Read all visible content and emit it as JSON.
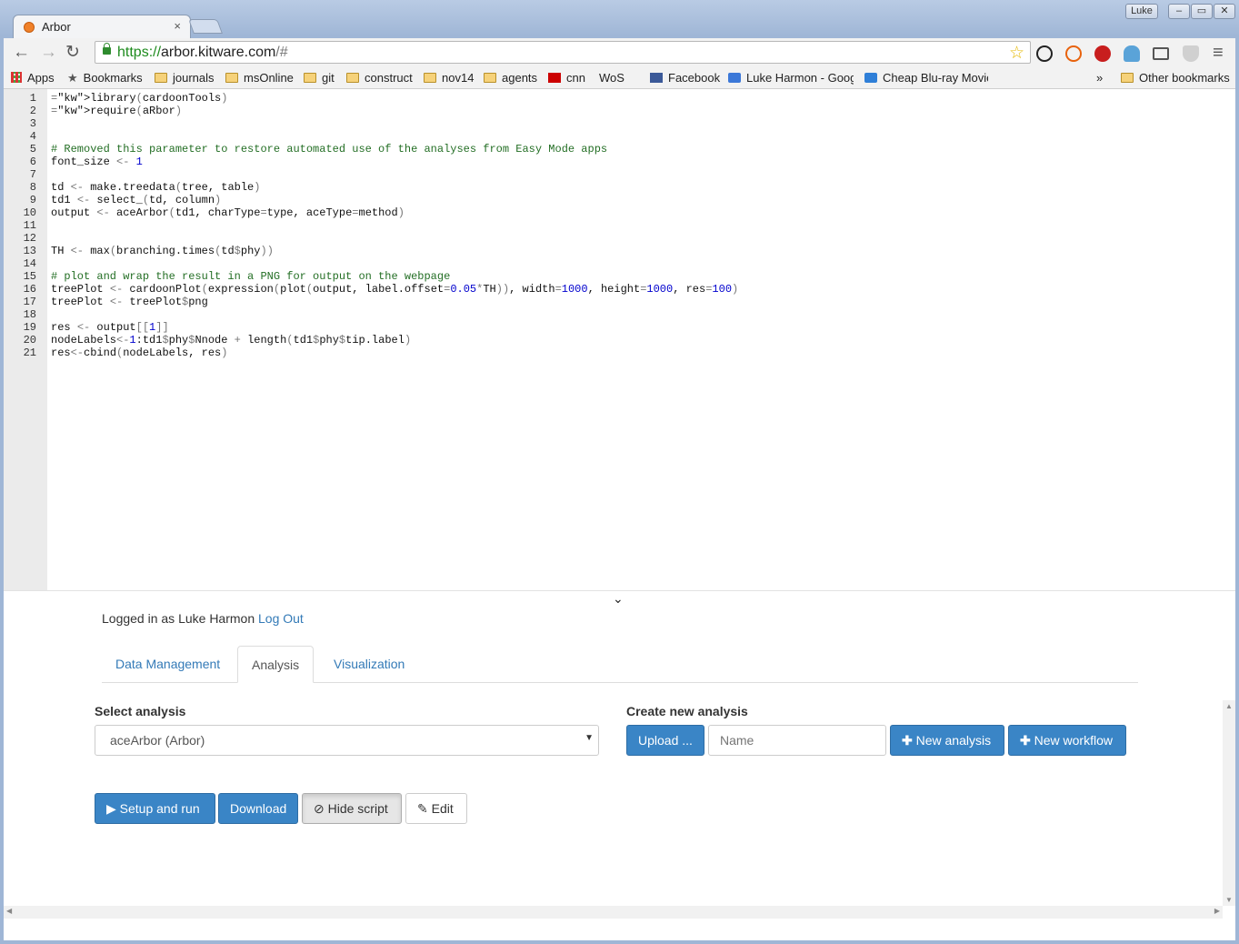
{
  "browser": {
    "tab_title": "Arbor",
    "tab_close": "×",
    "user_badge": "Luke",
    "window_controls": [
      "–",
      "▭",
      "✕"
    ],
    "url_scheme": "https://",
    "url_host": "arbor.kitware.com",
    "url_path": "/#",
    "back_glyph": "←",
    "forward_glyph": "→",
    "reload_glyph": "↻",
    "menu_glyph": "≡",
    "star_glyph": "☆",
    "bookmarks": [
      {
        "label": "Apps",
        "icon": "apps-icon"
      },
      {
        "label": "Bookmarks",
        "icon": "star-icon"
      },
      {
        "label": "journals",
        "icon": "folder-icon"
      },
      {
        "label": "msOnline",
        "icon": "folder-icon"
      },
      {
        "label": "git",
        "icon": "folder-icon"
      },
      {
        "label": "construct",
        "icon": "folder-icon"
      },
      {
        "label": "nov14",
        "icon": "folder-icon"
      },
      {
        "label": "agents",
        "icon": "folder-icon"
      },
      {
        "label": "cnn",
        "icon": "cnn-icon"
      },
      {
        "label": "WoS",
        "icon": "page-icon"
      },
      {
        "label": "Facebook",
        "icon": "facebook-icon"
      },
      {
        "label": "Luke Harmon - Googl",
        "icon": "google-scholar-icon"
      },
      {
        "label": "Cheap Blu-ray Movie",
        "icon": "bookmark-b-icon"
      }
    ],
    "overflow_glyph": "»",
    "other_bookmarks": "Other bookmarks"
  },
  "editor": {
    "line_numbers": [
      "1",
      "2",
      "3",
      "4",
      "5",
      "6",
      "7",
      "8",
      "9",
      "10",
      "11",
      "12",
      "13",
      "14",
      "15",
      "16",
      "17",
      "18",
      "19",
      "20",
      "21"
    ],
    "code_lines": [
      "library(cardoonTools)",
      "require(aRbor)",
      "",
      "",
      "# Removed this parameter to restore automated use of the analyses from Easy Mode apps",
      "font_size <- 1",
      "",
      "td <- make.treedata(tree, table)",
      "td1 <- select_(td, column)",
      "output <- aceArbor(td1, charType=type, aceType=method)",
      "",
      "",
      "TH <- max(branching.times(td$phy))",
      "",
      "# plot and wrap the result in a PNG for output on the webpage",
      "treePlot <- cardoonPlot(expression(plot(output, label.offset=0.05*TH)), width=1000, height=1000, res=100)",
      "treePlot <- treePlot$png",
      "",
      "res <- output[[1]]",
      "nodeLabels<-1:td1$phy$Nnode + length(td1$phy$tip.label)",
      "res<-cbind(nodeLabels, res)"
    ],
    "collapse_glyph": "⌄"
  },
  "app": {
    "logged_in_text": "Logged in as Luke Harmon",
    "logout_label": "Log Out",
    "tabs": [
      {
        "label": "Data Management",
        "active": false
      },
      {
        "label": "Analysis",
        "active": true
      },
      {
        "label": "Visualization",
        "active": false
      }
    ],
    "select_label": "Select analysis",
    "selected_analysis": "aceArbor (Arbor)",
    "select_caret": "▼",
    "create_label": "Create new analysis",
    "upload_label": "Upload ...",
    "name_placeholder": "Name",
    "new_analysis_label": "New analysis",
    "new_workflow_label": "New workflow",
    "setup_run_label": "Setup and run",
    "download_label": "Download",
    "hide_script_label": "Hide script",
    "edit_label": "Edit"
  },
  "colors": {
    "primary": "#3a85c6",
    "link": "#337ab7",
    "comment": "#236e24",
    "keyword": "#7a1e80",
    "number": "#0000cd"
  }
}
